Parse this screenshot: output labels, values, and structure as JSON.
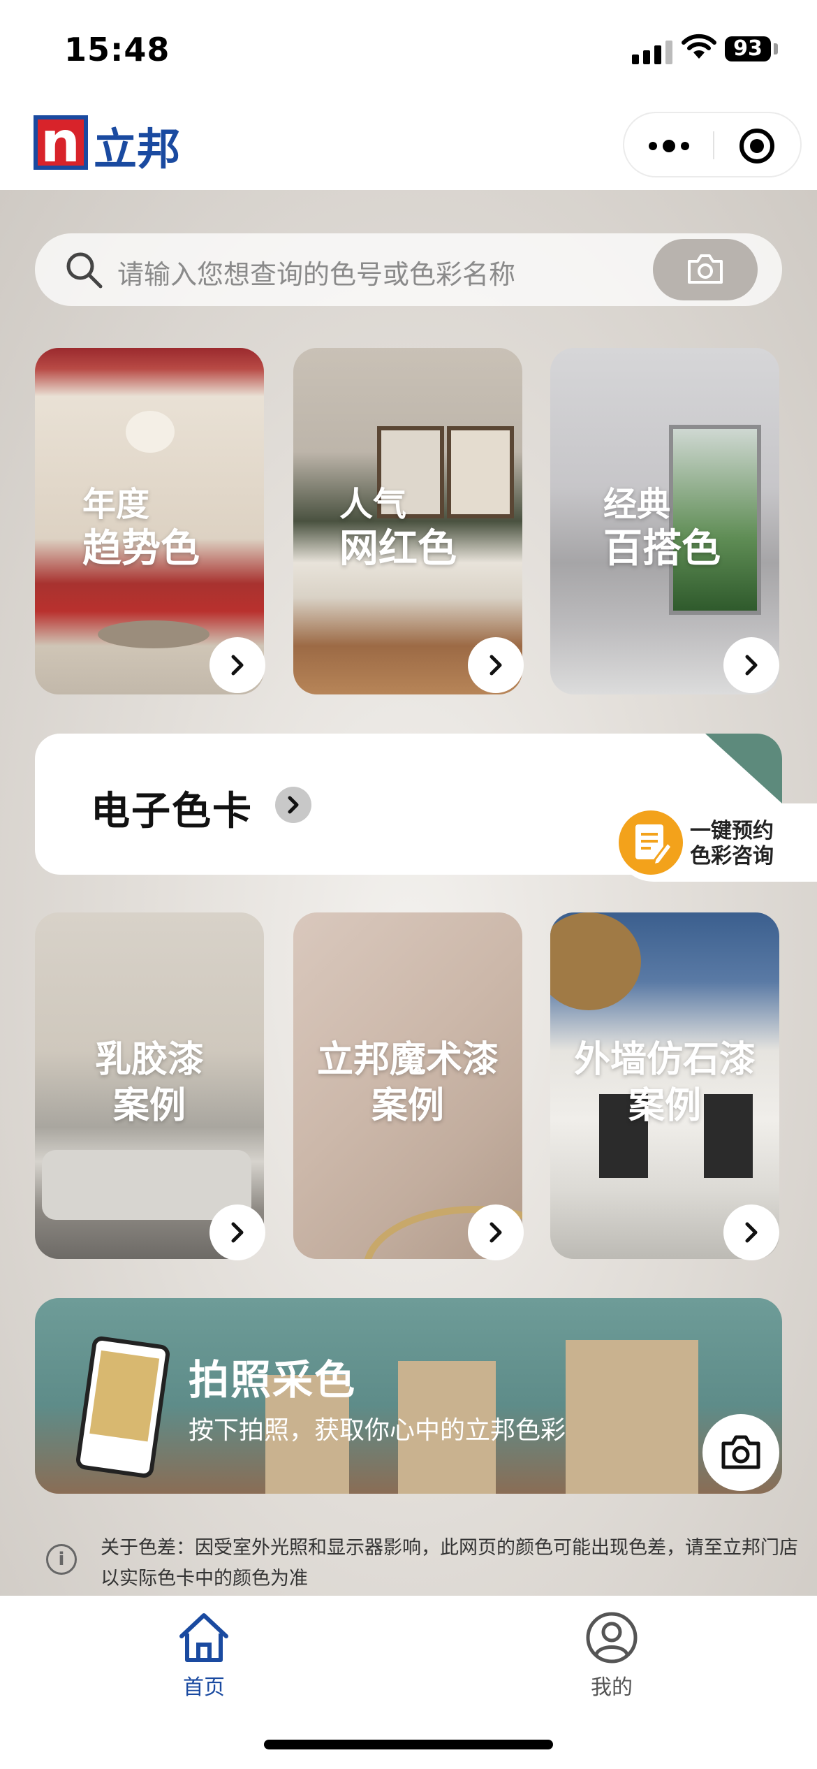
{
  "status": {
    "time": "15:48",
    "battery": "93"
  },
  "brand": {
    "logo_letter": "n",
    "name": "立邦"
  },
  "search": {
    "placeholder": "请输入您想查询的色号或色彩名称",
    "camera_icon": "camera-icon"
  },
  "color_cards": [
    {
      "line1": "年度",
      "line2": "趋势色"
    },
    {
      "line1": "人气",
      "line2": "网红色"
    },
    {
      "line1": "经典",
      "line2": "百搭色"
    }
  ],
  "swatch_card": {
    "title": "电子色卡"
  },
  "consult": {
    "line1": "一键预约",
    "line2": "色彩咨询"
  },
  "case_cards": [
    {
      "line1": "乳胶漆",
      "line2": "案例"
    },
    {
      "line1": "立邦魔术漆",
      "line2": "案例"
    },
    {
      "line1": "外墙仿石漆",
      "line2": "案例"
    }
  ],
  "photo_card": {
    "title": "拍照采色",
    "subtitle": "按下拍照，获取你心中的立邦色彩"
  },
  "notice": "关于色差：因受室外光照和显示器影响，此网页的颜色可能出现色差，请至立邦门店以实际色卡中的颜色为准",
  "tabs": [
    {
      "label": "首页",
      "icon": "home-icon",
      "active": true
    },
    {
      "label": "我的",
      "icon": "user-icon",
      "active": false
    }
  ],
  "colors": {
    "brand_blue": "#1a4aa0",
    "brand_red": "#d8232a",
    "consult_orange": "#f3a21b",
    "tab_active": "#1a4aa0",
    "tab_inactive": "#555555"
  }
}
